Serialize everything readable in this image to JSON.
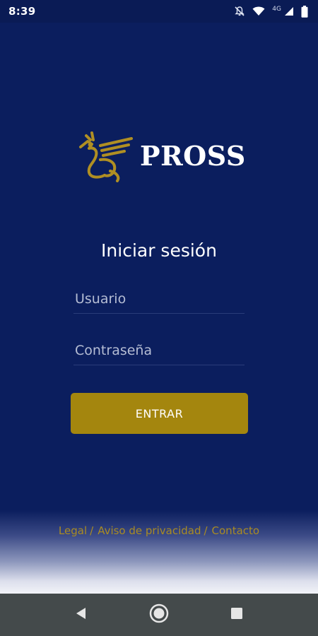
{
  "status_bar": {
    "time": "8:39",
    "network_label": "4G",
    "icons": [
      "notifications-off-icon",
      "wifi-icon",
      "signal-icon",
      "battery-icon"
    ]
  },
  "brand": {
    "name": "PROSS",
    "logo_icon": "griffin-logo-icon",
    "gold": "#a4860e",
    "navy": "#0b1e5e"
  },
  "login": {
    "title": "Iniciar sesión",
    "username_placeholder": "Usuario",
    "username_value": "",
    "password_placeholder": "Contraseña",
    "password_value": "",
    "submit_label": "ENTRAR"
  },
  "footer": {
    "links": [
      {
        "label": "Legal"
      },
      {
        "label": "Aviso de privacidad"
      },
      {
        "label": "Contacto"
      }
    ],
    "separator": "/"
  },
  "nav_bar": {
    "buttons": [
      "back-icon",
      "home-icon",
      "recents-icon"
    ]
  }
}
